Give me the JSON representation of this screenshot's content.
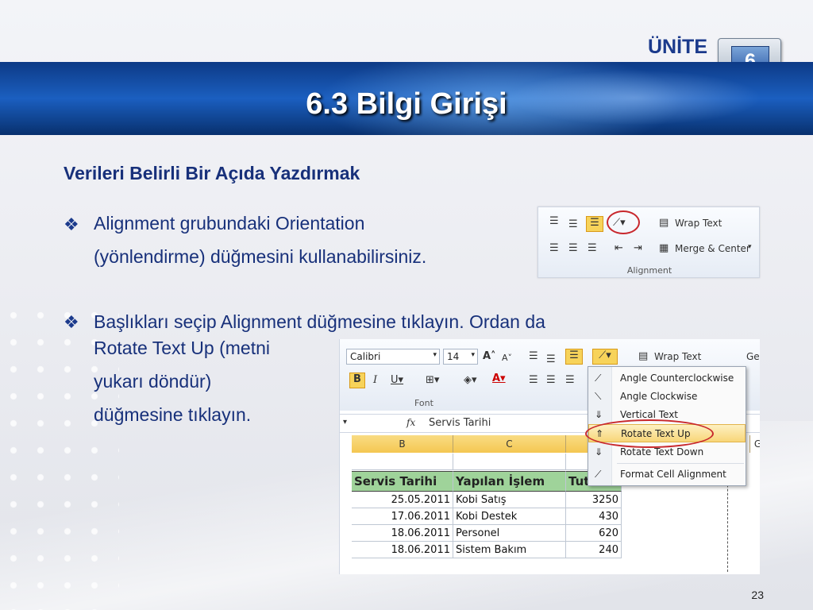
{
  "unit": {
    "label": "ÜNİTE",
    "number": "6"
  },
  "title": "6.3 Bilgi Girişi",
  "subheading": "Verileri Belirli Bir Açıda Yazdırmak",
  "bullet_symbol": "❖",
  "bullets": [
    {
      "lines": [
        "Alignment grubundaki Orientation",
        "(yönlendirme) düğmesini kullanabilirsiniz."
      ]
    },
    {
      "lines": [
        "Başlıkları seçip Alignment düğmesine tıklayın. Ordan da",
        "Rotate Text Up (metni",
        "yukarı döndür)",
        "düğmesine tıklayın."
      ]
    }
  ],
  "ribbon_alignment": {
    "wrap_text": "Wrap Text",
    "merge_center": "Merge & Center",
    "group_label": "Alignment"
  },
  "excel": {
    "font_name": "Calibri",
    "font_size": "14",
    "font_group_label": "Font",
    "wrap_text": "Wrap Text",
    "ge_partial": "Ge",
    "formula_fx": "fx",
    "formula_value": "Servis Tarihi",
    "columns": [
      "B",
      "C",
      "G"
    ],
    "headers": [
      "Servis Tarihi",
      "Yapılan İşlem",
      "Tutar"
    ],
    "rows": [
      [
        "25.05.2011",
        "Kobi Satış",
        "3250"
      ],
      [
        "17.06.2011",
        "Kobi Destek",
        "430"
      ],
      [
        "18.06.2011",
        "Personel",
        "620"
      ],
      [
        "18.06.2011",
        "Sistem Bakım",
        "240"
      ]
    ]
  },
  "orientation_menu": {
    "items": [
      "Angle Counterclockwise",
      "Angle Clockwise",
      "Vertical Text",
      "Rotate Text Up",
      "Rotate Text Down",
      "Format Cell Alignment"
    ],
    "selected": "Rotate Text Up"
  },
  "page_number": "23"
}
